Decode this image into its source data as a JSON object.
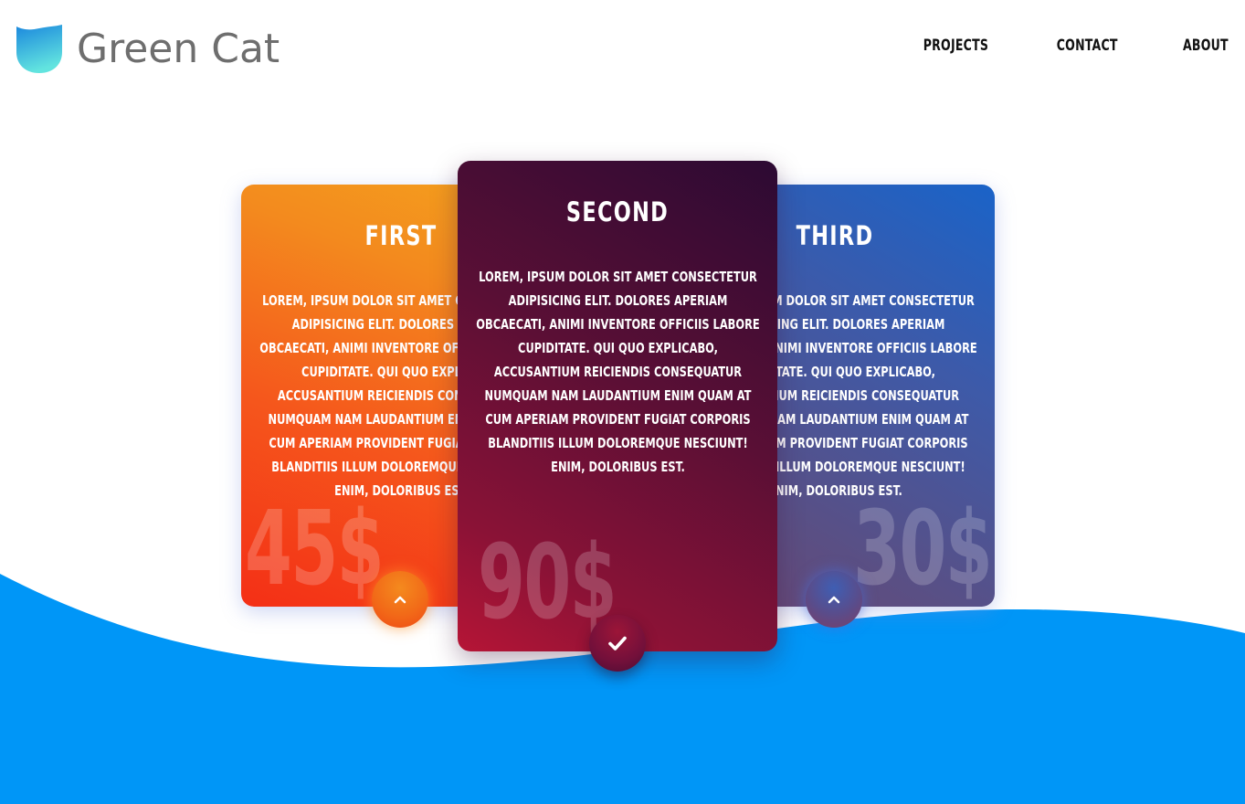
{
  "brand": {
    "name": "Green Cat",
    "logo_icon": "leaf-shield-icon",
    "logo_colors": [
      "#1c8ee0",
      "#5de0e0"
    ]
  },
  "nav": {
    "items": [
      {
        "label": "PROJECTS"
      },
      {
        "label": "CONTACT"
      },
      {
        "label": "ABOUT"
      }
    ]
  },
  "cards": [
    {
      "title": "FIRST",
      "body": "LOREM, IPSUM DOLOR SIT AMET CONSECTETUR ADIPISICING ELIT. DOLORES APERIAM OBCAECATI, ANIMI INVENTORE OFFICIIS LABORE CUPIDITATE. QUI QUO EXPLICABO, ACCUSANTIUM REICIENDIS CONSEQUATUR NUMQUAM NAM LAUDANTIUM ENIM QUAM AT CUM APERIAM PROVIDENT FUGIAT CORPORIS BLANDITIIS ILLUM DOLOREMQUE NESCIUNT! ENIM, DOLORIBUS EST.",
      "price": "45$",
      "button_icon": "chevron-up-icon",
      "accent": "#f5571c"
    },
    {
      "title": "SECOND",
      "body": "LOREM, IPSUM DOLOR SIT AMET CONSECTETUR ADIPISICING ELIT. DOLORES APERIAM OBCAECATI, ANIMI INVENTORE OFFICIIS LABORE CUPIDITATE. QUI QUO EXPLICABO, ACCUSANTIUM REICIENDIS CONSEQUATUR NUMQUAM NAM LAUDANTIUM ENIM QUAM AT CUM APERIAM PROVIDENT FUGIAT CORPORIS BLANDITIIS ILLUM DOLOREMQUE NESCIUNT! ENIM, DOLORIBUS EST.",
      "price": "90$",
      "button_icon": "check-icon",
      "accent": "#8a1236"
    },
    {
      "title": "THIRD",
      "body": "LOREM, IPSUM DOLOR SIT AMET CONSECTETUR ADIPISICING ELIT. DOLORES APERIAM OBCAECATI, ANIMI INVENTORE OFFICIIS LABORE CUPIDITATE. QUI QUO EXPLICABO, ACCUSANTIUM REICIENDIS CONSEQUATUR NUMQUAM NAM LAUDANTIUM ENIM QUAM AT CUM APERIAM PROVIDENT FUGIAT CORPORIS BLANDITIIS ILLUM DOLOREMQUE NESCIUNT! ENIM, DOLORIBUS EST.",
      "price": "30$",
      "button_icon": "chevron-up-icon",
      "accent": "#3d5aa9"
    }
  ],
  "colors": {
    "wave": "#0096f7",
    "background": "#ffffff"
  }
}
